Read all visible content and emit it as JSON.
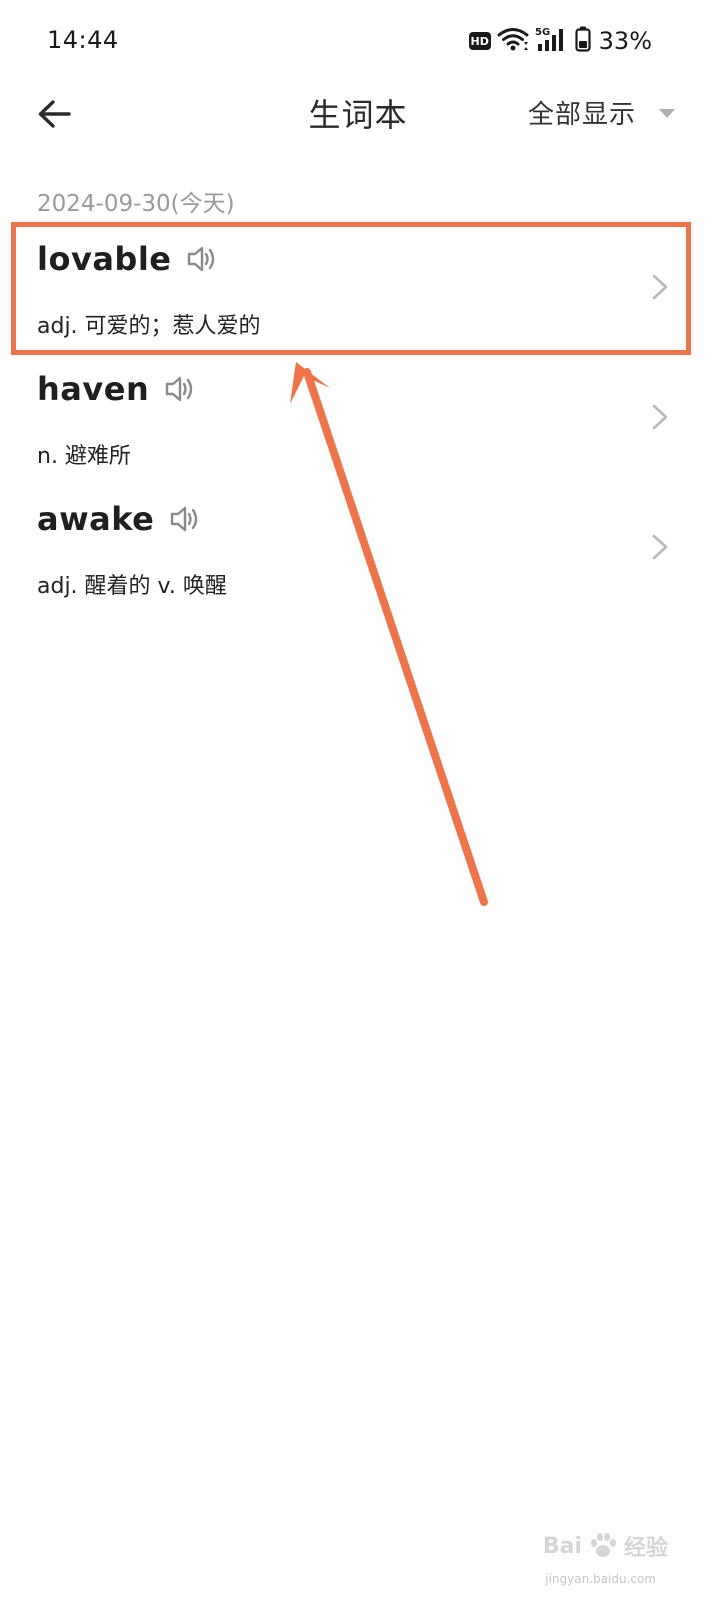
{
  "status_bar": {
    "time": "14:44",
    "hd_badge": "HD",
    "network": "5G",
    "battery": "33%"
  },
  "header": {
    "title": "生词本",
    "filter_label": "全部显示"
  },
  "list": {
    "date_header": "2024-09-30(今天)",
    "words": [
      {
        "word": "lovable",
        "definition": "adj. 可爱的；惹人爱的"
      },
      {
        "word": "haven",
        "definition": "n. 避难所"
      },
      {
        "word": "awake",
        "definition": "adj. 醒着的 v. 唤醒"
      }
    ]
  },
  "watermark": {
    "brand": "Bai",
    "brand_suffix": "经验",
    "domain": "jingyan.baidu.com"
  },
  "colors": {
    "annotation": "#f07347",
    "text_primary": "#1f1f1f",
    "text_secondary": "#9a9a9a",
    "icon_gray": "#8a8a8a",
    "chevron": "#b8b8b8"
  },
  "icons": {
    "back": "arrow-left-icon",
    "dropdown": "triangle-down-icon",
    "speaker": "speaker-icon",
    "chevron": "chevron-right-icon"
  }
}
